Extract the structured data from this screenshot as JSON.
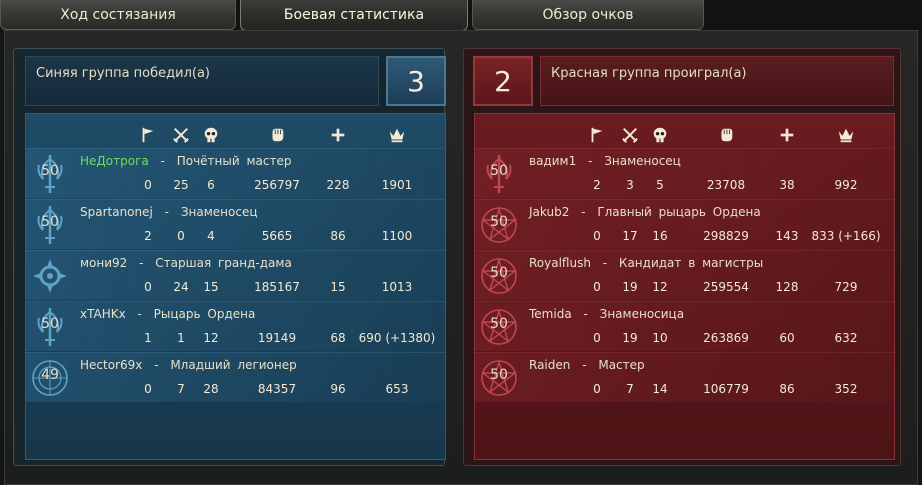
{
  "tabs": [
    {
      "label": "Ход состязания"
    },
    {
      "label": "Боевая статистика"
    },
    {
      "label": "Обзор очков"
    }
  ],
  "blue": {
    "result": "Синяя группа победил(а)",
    "score": "3",
    "players": [
      {
        "level": "50",
        "name": "НеДотрога",
        "title": "Почётный мастер",
        "flags": "0",
        "kills": "25",
        "deaths": "6",
        "damage": "256797",
        "heal": "228",
        "points": "1901"
      },
      {
        "level": "50",
        "name": "Spartanonej",
        "title": "Знаменосец",
        "flags": "2",
        "kills": "0",
        "deaths": "4",
        "damage": "5665",
        "heal": "86",
        "points": "1100"
      },
      {
        "level": "",
        "name": "мони92",
        "title": "Старшая гранд-дама",
        "flags": "0",
        "kills": "24",
        "deaths": "15",
        "damage": "185167",
        "heal": "15",
        "points": "1013"
      },
      {
        "level": "50",
        "name": "xTAHKx",
        "title": "Рыцарь Ордена",
        "flags": "1",
        "kills": "1",
        "deaths": "12",
        "damage": "19149",
        "heal": "68",
        "points": "690 (+1380)"
      },
      {
        "level": "49",
        "name": "Hector69x",
        "title": "Младший легионер",
        "flags": "0",
        "kills": "7",
        "deaths": "28",
        "damage": "84357",
        "heal": "96",
        "points": "653"
      }
    ]
  },
  "red": {
    "result": "Красная группа проиграл(а)",
    "score": "2",
    "players": [
      {
        "level": "50",
        "name": "вадим1",
        "title": "Знаменосец",
        "flags": "2",
        "kills": "3",
        "deaths": "5",
        "damage": "23708",
        "heal": "38",
        "points": "992"
      },
      {
        "level": "50",
        "name": "Jakub2",
        "title": "Главный рыцарь Ордена",
        "flags": "0",
        "kills": "17",
        "deaths": "16",
        "damage": "298829",
        "heal": "143",
        "points": "833 (+166)"
      },
      {
        "level": "50",
        "name": "Royalflush",
        "title": "Кандидат в магистры",
        "flags": "0",
        "kills": "19",
        "deaths": "12",
        "damage": "259554",
        "heal": "128",
        "points": "729"
      },
      {
        "level": "50",
        "name": "Temida",
        "title": "Знаменосица",
        "flags": "0",
        "kills": "19",
        "deaths": "10",
        "damage": "263869",
        "heal": "60",
        "points": "632"
      },
      {
        "level": "50",
        "name": "Raiden",
        "title": "Мастер",
        "flags": "0",
        "kills": "7",
        "deaths": "14",
        "damage": "106779",
        "heal": "86",
        "points": "352"
      }
    ]
  },
  "columns": [
    {
      "icon": "flag-icon"
    },
    {
      "icon": "crossed-swords-icon"
    },
    {
      "icon": "skull-icon"
    },
    {
      "icon": "fist-icon"
    },
    {
      "icon": "plus-icon"
    },
    {
      "icon": "crown-icon"
    }
  ],
  "separator": "-",
  "colors": {
    "highlight_name": "#6be05a",
    "blue_team": "#1f4b66",
    "red_team": "#6a1c20"
  }
}
